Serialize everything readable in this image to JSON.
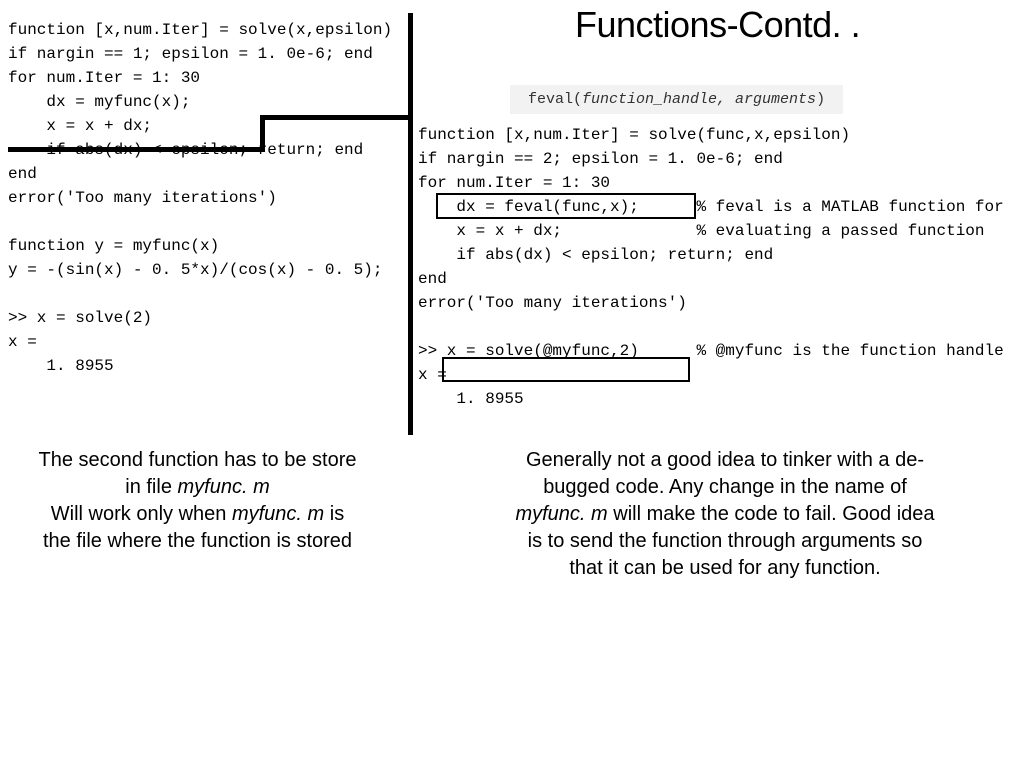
{
  "title": "Functions-Contd. .",
  "feval_banner": {
    "fn": "feval(",
    "args": "function_handle, arguments",
    "close": ")"
  },
  "code_left": "function [x,num.Iter] = solve(x,epsilon)\nif nargin == 1; epsilon = 1. 0e-6; end\nfor num.Iter = 1: 30\n    dx = myfunc(x);\n    x = x + dx;\n    if abs(dx) < epsilon; return; end\nend\nerror('Too many iterations')\n\nfunction y = myfunc(x)\ny = -(sin(x) - 0. 5*x)/(cos(x) - 0. 5);\n\n>> x = solve(2)\nx =\n    1. 8955",
  "code_right": "function [x,num.Iter] = solve(func,x,epsilon)\nif nargin == 2; epsilon = 1. 0e-6; end\nfor num.Iter = 1: 30\n    dx = feval(func,x);      % feval is a MATLAB function for\n    x = x + dx;              % evaluating a passed function\n    if abs(dx) < epsilon; return; end\nend\nerror('Too many iterations')\n\n>> x = solve(@myfunc,2)      % @myfunc is the function handle\nx =\n    1. 8955",
  "caption_left": {
    "l1": "The second function has to be store",
    "l2a": "in file ",
    "l2b": "myfunc. m",
    "l3a": "Will work only when ",
    "l3b": "myfunc. m",
    "l3c": " is",
    "l4": "the file where the function is stored"
  },
  "caption_right": {
    "l1": "Generally not a good idea to tinker with a de-",
    "l2": "bugged code. Any change in the name of",
    "l3a": "myfunc. m",
    "l3b": " will make the code to fail. Good idea",
    "l4": "is to send the function through arguments so",
    "l5": "that it can be used for any function."
  }
}
